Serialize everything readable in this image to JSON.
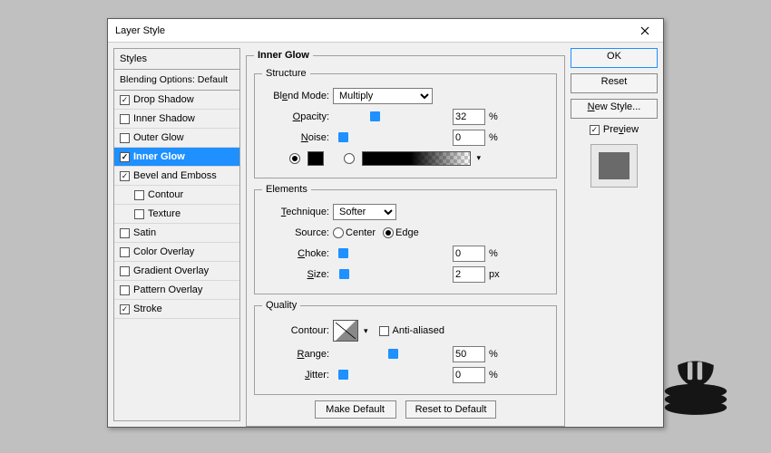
{
  "title": "Layer Style",
  "close_aria": "Close",
  "left": {
    "heading": "Styles",
    "blending": "Blending Options: Default",
    "items": [
      {
        "label": "Drop Shadow",
        "checked": true,
        "selected": false,
        "indent": false
      },
      {
        "label": "Inner Shadow",
        "checked": false,
        "selected": false,
        "indent": false
      },
      {
        "label": "Outer Glow",
        "checked": false,
        "selected": false,
        "indent": false
      },
      {
        "label": "Inner Glow",
        "checked": true,
        "selected": true,
        "indent": false
      },
      {
        "label": "Bevel and Emboss",
        "checked": true,
        "selected": false,
        "indent": false
      },
      {
        "label": "Contour",
        "checked": false,
        "selected": false,
        "indent": true
      },
      {
        "label": "Texture",
        "checked": false,
        "selected": false,
        "indent": true
      },
      {
        "label": "Satin",
        "checked": false,
        "selected": false,
        "indent": false
      },
      {
        "label": "Color Overlay",
        "checked": false,
        "selected": false,
        "indent": false
      },
      {
        "label": "Gradient Overlay",
        "checked": false,
        "selected": false,
        "indent": false
      },
      {
        "label": "Pattern Overlay",
        "checked": false,
        "selected": false,
        "indent": false
      },
      {
        "label": "Stroke",
        "checked": true,
        "selected": false,
        "indent": false
      }
    ]
  },
  "center": {
    "main_legend": "Inner Glow",
    "structure": {
      "legend": "Structure",
      "blend_mode_label": "Blend Mode:",
      "blend_mode_value": "Multiply",
      "opacity_label": "Opacity:",
      "opacity_value": "32",
      "opacity_pct": 32,
      "noise_label": "Noise:",
      "noise_value": "0",
      "noise_pct": 0,
      "pct": "%"
    },
    "elements": {
      "legend": "Elements",
      "technique_label": "Technique:",
      "technique_value": "Softer",
      "source_label": "Source:",
      "center": "Center",
      "edge": "Edge",
      "source_selected": "Edge",
      "choke_label": "Choke:",
      "choke_value": "0",
      "choke_pct": 0,
      "size_label": "Size:",
      "size_value": "2",
      "size_pct": 1,
      "pct": "%",
      "px": "px"
    },
    "quality": {
      "legend": "Quality",
      "contour_label": "Contour:",
      "anti_aliased": "Anti-aliased",
      "range_label": "Range:",
      "range_value": "50",
      "range_pct": 50,
      "jitter_label": "Jitter:",
      "jitter_value": "0",
      "jitter_pct": 0,
      "pct": "%"
    },
    "make_default": "Make Default",
    "reset_default": "Reset to Default"
  },
  "right": {
    "ok": "OK",
    "reset": "Reset",
    "new_style": "New Style...",
    "preview": "Preview"
  }
}
